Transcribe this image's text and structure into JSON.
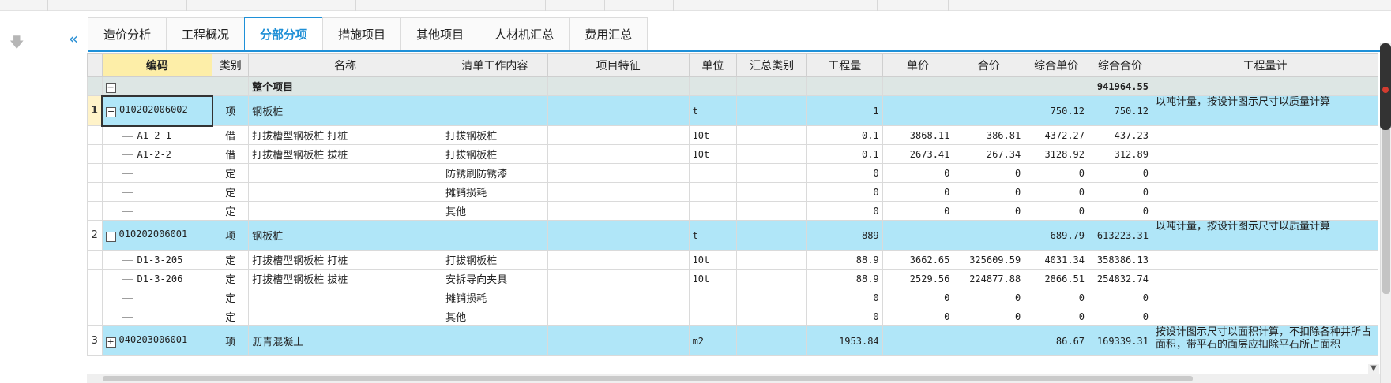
{
  "tabs": [
    "造价分析",
    "工程概况",
    "分部分项",
    "措施项目",
    "其他项目",
    "人材机汇总",
    "费用汇总"
  ],
  "active_tab": 2,
  "icons": {
    "down": "arrow-down-icon",
    "collapse": "double-chevron-left-icon"
  },
  "colors": {
    "accent": "#1e90d8",
    "main_row": "#b0e6f8",
    "code_header": "#fdeea8",
    "total_row": "#dde6e4"
  },
  "columns": [
    "编码",
    "类别",
    "名称",
    "清单工作内容",
    "项目特征",
    "单位",
    "汇总类别",
    "工程量",
    "单价",
    "合价",
    "综合单价",
    "综合合价",
    "工程量计"
  ],
  "total_row": {
    "name": "整个项目",
    "total": "941964.55"
  },
  "rows": [
    {
      "kind": "main",
      "no": "1",
      "code": "010202006002",
      "cat": "项",
      "name": "钢板桩",
      "content": "",
      "feature": "",
      "unit": "t",
      "sumcat": "",
      "qty": "1",
      "price": "",
      "amount": "",
      "cprice": "750.12",
      "camount": "750.12",
      "rule": "以吨计量，按设计图示尺寸以质量计算"
    },
    {
      "kind": "sub",
      "code": "A1-2-1",
      "cat": "借",
      "name": "打拔槽型钢板桩 打桩",
      "content": "打拔钢板桩",
      "unit": "10t",
      "qty": "0.1",
      "price": "3868.11",
      "amount": "386.81",
      "cprice": "4372.27",
      "camount": "437.23"
    },
    {
      "kind": "sub",
      "code": "A1-2-2",
      "cat": "借",
      "name": "打拔槽型钢板桩 拔桩",
      "content": "打拔钢板桩",
      "unit": "10t",
      "qty": "0.1",
      "price": "2673.41",
      "amount": "267.34",
      "cprice": "3128.92",
      "camount": "312.89"
    },
    {
      "kind": "sub",
      "code": "",
      "cat": "定",
      "name": "",
      "content": "防锈刷防锈漆",
      "unit": "",
      "qty": "0",
      "price": "0",
      "amount": "0",
      "cprice": "0",
      "camount": "0"
    },
    {
      "kind": "sub",
      "code": "",
      "cat": "定",
      "name": "",
      "content": "摊销损耗",
      "unit": "",
      "qty": "0",
      "price": "0",
      "amount": "0",
      "cprice": "0",
      "camount": "0"
    },
    {
      "kind": "sub",
      "code": "",
      "cat": "定",
      "name": "",
      "content": "其他",
      "unit": "",
      "qty": "0",
      "price": "0",
      "amount": "0",
      "cprice": "0",
      "camount": "0"
    },
    {
      "kind": "main",
      "no": "2",
      "code": "010202006001",
      "cat": "项",
      "name": "钢板桩",
      "content": "",
      "feature": "",
      "unit": "t",
      "sumcat": "",
      "qty": "889",
      "price": "",
      "amount": "",
      "cprice": "689.79",
      "camount": "613223.31",
      "rule": "以吨计量，按设计图示尺寸以质量计算"
    },
    {
      "kind": "sub",
      "code": "D1-3-205",
      "cat": "定",
      "name": "打拔槽型钢板桩 打桩",
      "content": "打拔钢板桩",
      "unit": "10t",
      "qty": "88.9",
      "price": "3662.65",
      "amount": "325609.59",
      "cprice": "4031.34",
      "camount": "358386.13"
    },
    {
      "kind": "sub",
      "code": "D1-3-206",
      "cat": "定",
      "name": "打拔槽型钢板桩 拔桩",
      "content": "安拆导向夹具",
      "unit": "10t",
      "qty": "88.9",
      "price": "2529.56",
      "amount": "224877.88",
      "cprice": "2866.51",
      "camount": "254832.74"
    },
    {
      "kind": "sub",
      "code": "",
      "cat": "定",
      "name": "",
      "content": "摊销损耗",
      "unit": "",
      "qty": "0",
      "price": "0",
      "amount": "0",
      "cprice": "0",
      "camount": "0"
    },
    {
      "kind": "sub",
      "code": "",
      "cat": "定",
      "name": "",
      "content": "其他",
      "unit": "",
      "qty": "0",
      "price": "0",
      "amount": "0",
      "cprice": "0",
      "camount": "0"
    },
    {
      "kind": "main",
      "no": "3",
      "code": "040203006001",
      "cat": "项",
      "name": "沥青混凝土",
      "content": "",
      "feature": "",
      "unit": "m2",
      "sumcat": "",
      "qty": "1953.84",
      "price": "",
      "amount": "",
      "cprice": "86.67",
      "camount": "169339.31",
      "rule": "按设计图示尺寸以面积计算，不扣除各种井所占面积，带平石的面层应扣除平石所占面积",
      "collapsed": true
    }
  ]
}
